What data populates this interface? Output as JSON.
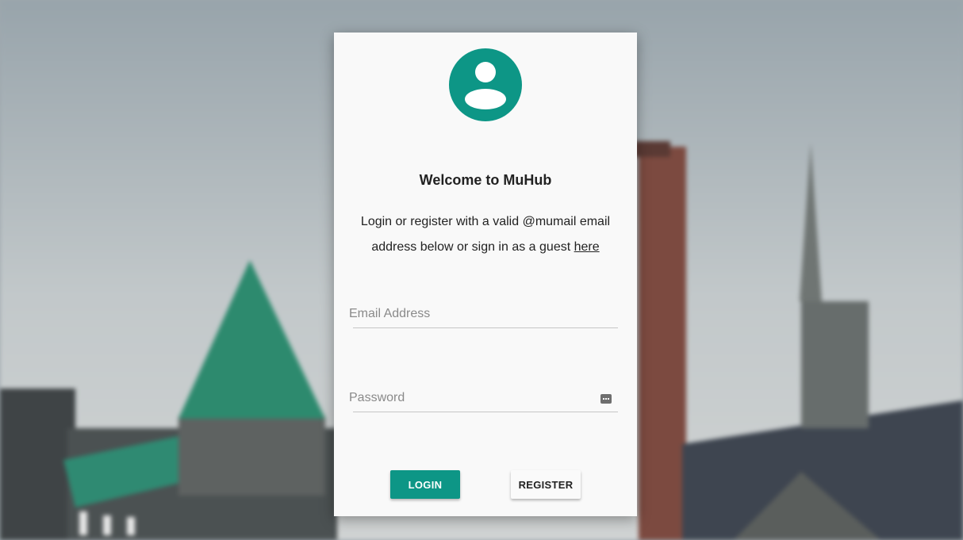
{
  "login_card": {
    "title": "Welcome to MuHub",
    "description": "Login or register with a valid @mumail email address below or sign in as a guest",
    "guest_link": "here",
    "email_placeholder": "Email Address",
    "password_placeholder": "Password",
    "login_button": "LOGIN",
    "register_button": "REGISTER"
  },
  "icons": {
    "avatar": "account-circle-icon",
    "password": "password-dots-icon"
  },
  "colors": {
    "accent": "#0d9686",
    "card_background": "#f9f9f9",
    "text": "#222222"
  }
}
